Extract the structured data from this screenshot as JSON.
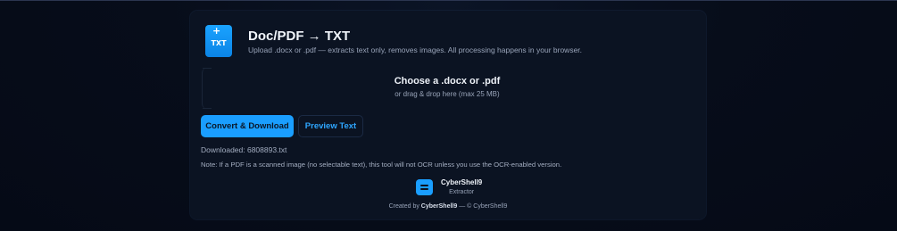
{
  "header": {
    "icon_plus": "+",
    "icon_ext": "TXT",
    "title": "Doc/PDF → TXT",
    "subtitle": "Upload .docx or .pdf — extracts text only, removes images. All processing happens in your browser."
  },
  "dropzone": {
    "title": "Choose a .docx or .pdf",
    "subtitle": "or drag & drop here (max 25 MB)"
  },
  "actions": {
    "convert_label": "Convert & Download",
    "preview_label": "Preview Text"
  },
  "status": {
    "downloaded": "Downloaded: 6808893.txt"
  },
  "note": "Note: If a PDF is a scanned image (no selectable text), this tool will not OCR unless you use the OCR-enabled version.",
  "brand": {
    "name": "CyberShell9",
    "subtitle": "Extractor"
  },
  "credit": {
    "prefix": "Created by ",
    "author": "CyberShell9",
    "suffix": " — © CyberShell9"
  },
  "colors": {
    "accent": "#1a9eff",
    "card_bg": "#0b1322",
    "page_bg": "#070d1a"
  },
  "icons": {
    "file": "file-txt-icon",
    "brand": "equals-logo-icon"
  }
}
